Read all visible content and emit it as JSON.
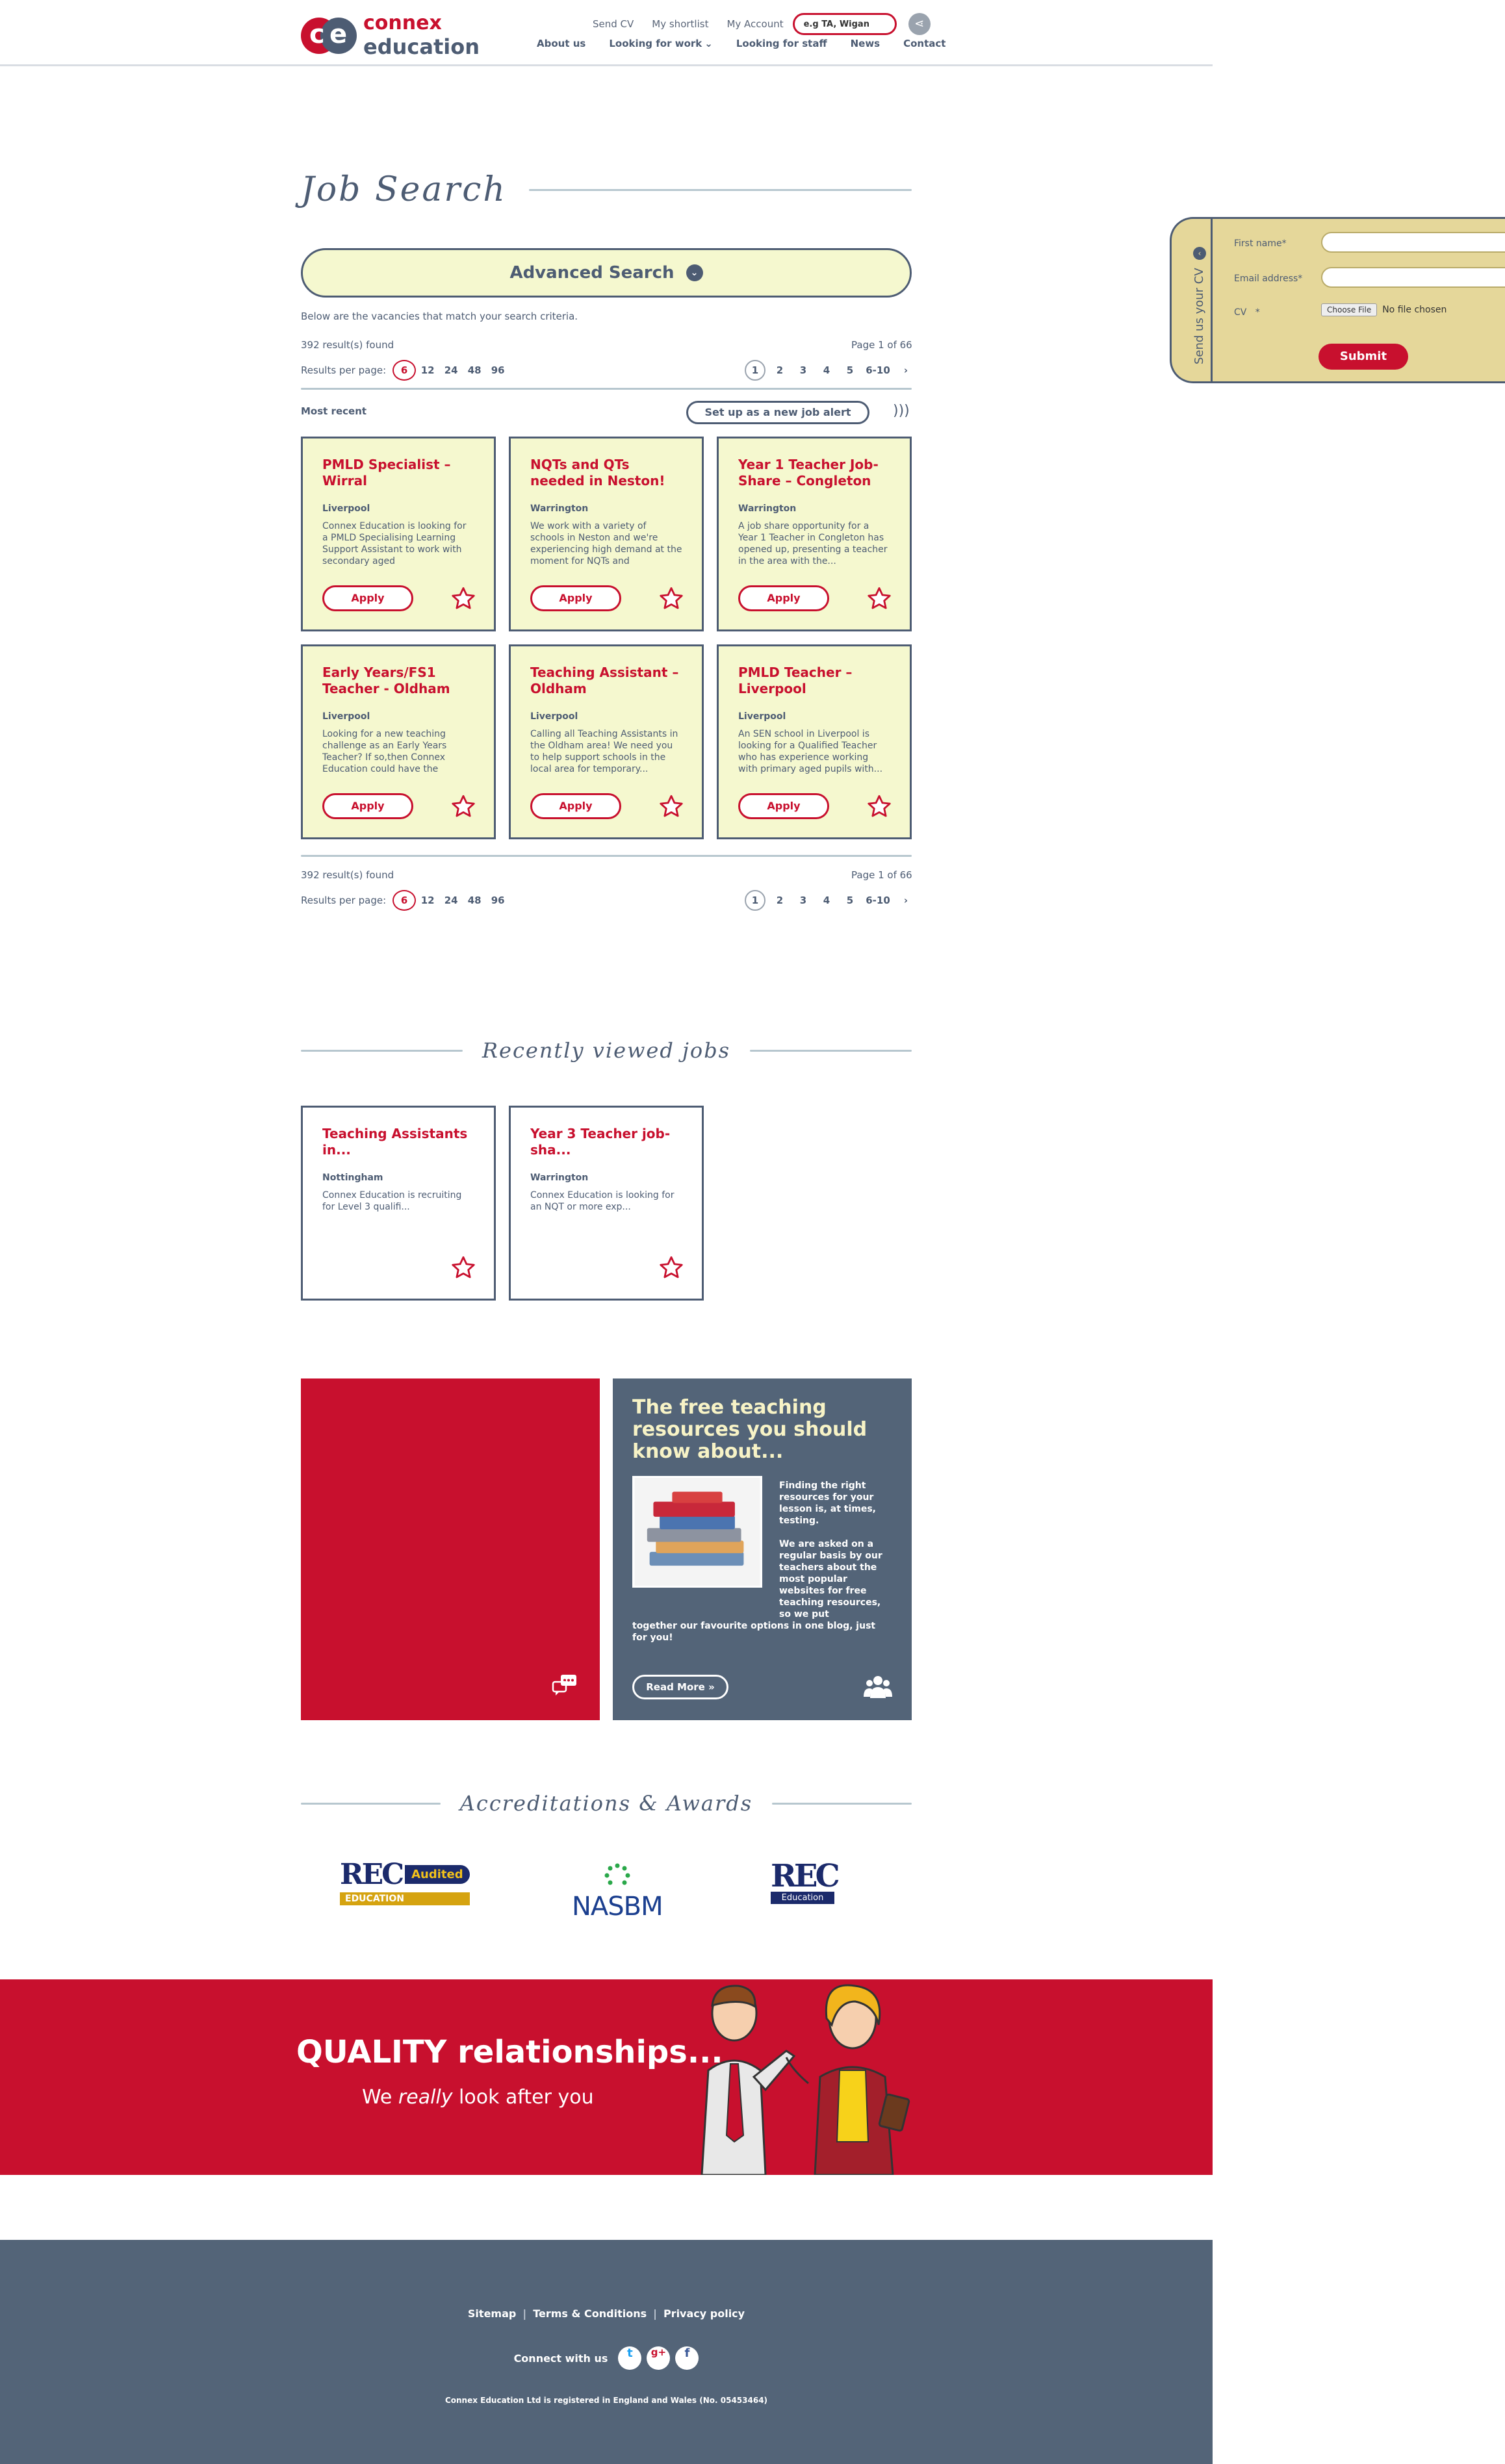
{
  "brand": {
    "logo_line1": "connex",
    "logo_line2": "education",
    "logo_letters": "ce"
  },
  "header": {
    "toplinks": [
      "Send CV",
      "My shortlist",
      "My Account"
    ],
    "search_placeholder": "e.g TA, Wigan",
    "nav": [
      "About us",
      "Looking for work",
      "Looking for staff",
      "News",
      "Contact"
    ]
  },
  "page": {
    "title": "Job Search",
    "advanced_search": "Advanced Search",
    "intro": "Below are the vacancies that match your search criteria.",
    "results_found": "392 result(s) found",
    "page_of": "Page 1 of 66",
    "results_per_page_label": "Results per page:",
    "per_page_options": [
      "6",
      "12",
      "24",
      "48",
      "96"
    ],
    "pages": [
      "1",
      "2",
      "3",
      "4",
      "5",
      "6-10"
    ],
    "sort_label": "Most recent",
    "job_alert": "Set up as a new job alert"
  },
  "jobs": [
    {
      "title": "PMLD Specialist – Wirral",
      "location": "Liverpool",
      "desc": "Connex Education is looking for a PMLD Specialising Learning Support Assistant to work with secondary aged",
      "apply": "Apply"
    },
    {
      "title": "NQTs and QTs needed in Neston!",
      "location": "Warrington",
      "desc": "We work with a variety of schools in Neston and we're experiencing high demand at the moment for NQTs and",
      "apply": "Apply"
    },
    {
      "title": "Year 1 Teacher Job-Share – Congleton",
      "location": "Warrington",
      "desc": "A job share opportunity for a Year 1 Teacher in Congleton has opened up, presenting a teacher in the area with the...",
      "apply": "Apply"
    },
    {
      "title": "Early Years/FS1 Teacher - Oldham",
      "location": "Liverpool",
      "desc": "Looking for a new teaching challenge as an Early Years Teacher? If so,then Connex Education could have the",
      "apply": "Apply"
    },
    {
      "title": "Teaching Assistant – Oldham",
      "location": "Liverpool",
      "desc": "Calling all Teaching Assistants in the Oldham area! We need you to help support schools in the local area for temporary...",
      "apply": "Apply"
    },
    {
      "title": "PMLD Teacher – Liverpool",
      "location": "Liverpool",
      "desc": "An SEN school in Liverpool is looking for a Qualified Teacher who has experience working with primary aged pupils with...",
      "apply": "Apply"
    }
  ],
  "recent": {
    "heading": "Recently viewed jobs",
    "items": [
      {
        "title": "Teaching Assistants in...",
        "location": "Nottingham",
        "desc": "Connex Education is recruiting for Level 3 qualifi..."
      },
      {
        "title": "Year 3 Teacher job-sha...",
        "location": "Warrington",
        "desc": "Connex Education is looking for an NQT or more exp..."
      }
    ]
  },
  "promo": {
    "heading": "The free teaching resources you should know about...",
    "p1": "Finding the right resources for your lesson is, at times, testing.",
    "p2": "We are asked on a regular basis by our teachers about the most popular websites for free teaching resources, so we put",
    "p3": "together our favourite options in one blog, just for you!",
    "read_more": "Read More »"
  },
  "accreditations": {
    "heading": "Accreditations & Awards",
    "rec_audited": {
      "mark": "REC",
      "badge": "Audited",
      "sub": "EDUCATION"
    },
    "nasbm": "NASBM",
    "rec_education": {
      "mark": "REC",
      "sub": "Education"
    }
  },
  "banner": {
    "line1": "QUALITY relationships...",
    "line2_pre": "We ",
    "line2_em": "really",
    "line2_post": " look after you"
  },
  "footer": {
    "links": [
      "Sitemap",
      "Terms & Conditions",
      "Privacy policy"
    ],
    "connect": "Connect with us",
    "social": [
      "twitter",
      "google-plus",
      "facebook"
    ],
    "legal": "Connex Education Ltd is registered in England and Wales (No. 05453464)"
  },
  "cv_form": {
    "tab_label": "Send us your CV",
    "first_name": "First name*",
    "email": "Email address*",
    "cv": "CV   *",
    "choose_file": "Choose File",
    "no_file": "No file chosen",
    "submit": "Submit"
  },
  "colors": {
    "brand_red": "#c8102e",
    "slate": "#4d5c73",
    "card_bg": "#f5f8cf",
    "footer": "#536478",
    "cv_tab": "#e5d79a"
  }
}
